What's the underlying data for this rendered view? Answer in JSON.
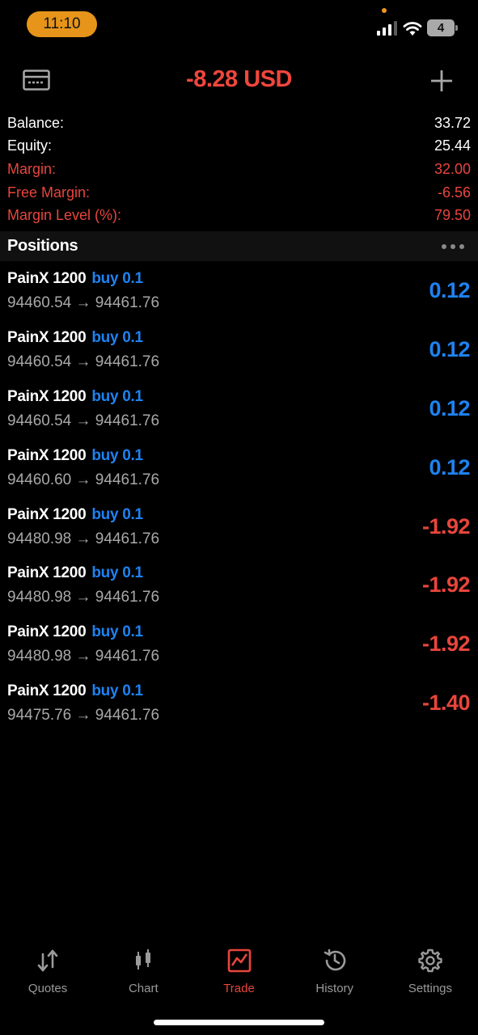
{
  "status_bar": {
    "time": "11:10",
    "battery": "4",
    "icons": [
      "signal-icon",
      "wifi-icon",
      "battery-icon"
    ]
  },
  "header": {
    "title": "-8.28 USD",
    "left_icon": "wallet-icon",
    "right_icon": "add-icon"
  },
  "summary": [
    {
      "label": "Balance:",
      "value": "33.72"
    },
    {
      "label": "Equity:",
      "value": "25.44"
    },
    {
      "label": "Margin:",
      "value": "32.00"
    },
    {
      "label": "Free Margin:",
      "value": "-6.56"
    },
    {
      "label": "Margin Level (%):",
      "value": "79.50"
    }
  ],
  "positions": {
    "title": "Positions",
    "items": [
      {
        "symbol": "PainX 1200",
        "side": "buy 0.1",
        "prices": "94460.54 → 94461.76",
        "profit": "0.12"
      },
      {
        "symbol": "PainX 1200",
        "side": "buy 0.1",
        "prices": "94460.54 → 94461.76",
        "profit": "0.12"
      },
      {
        "symbol": "PainX 1200",
        "side": "buy 0.1",
        "prices": "94460.54 → 94461.76",
        "profit": "0.12"
      },
      {
        "symbol": "PainX 1200",
        "side": "buy 0.1",
        "prices": "94460.60 → 94461.76",
        "profit": "0.12"
      },
      {
        "symbol": "PainX 1200",
        "side": "buy 0.1",
        "prices": "94480.98 → 94461.76",
        "profit": "-1.92"
      },
      {
        "symbol": "PainX 1200",
        "side": "buy 0.1",
        "prices": "94480.98 → 94461.76",
        "profit": "-1.92"
      },
      {
        "symbol": "PainX 1200",
        "side": "buy 0.1",
        "prices": "94480.98 → 94461.76",
        "profit": "-1.92"
      },
      {
        "symbol": "PainX 1200",
        "side": "buy 0.1",
        "prices": "94475.76 → 94461.76",
        "profit": "-1.40"
      }
    ]
  },
  "tabs": [
    {
      "label": "Quotes",
      "icon": "quotes-icon"
    },
    {
      "label": "Chart",
      "icon": "chart-icon"
    },
    {
      "label": "Trade",
      "icon": "trade-icon",
      "active": true
    },
    {
      "label": "History",
      "icon": "history-icon"
    },
    {
      "label": "Settings",
      "icon": "settings-icon"
    }
  ],
  "colors": {
    "accent": "#e8453c",
    "profit_positive": "#1e82f0",
    "profit_negative": "#e8453c",
    "status_pill": "#e6951a"
  }
}
